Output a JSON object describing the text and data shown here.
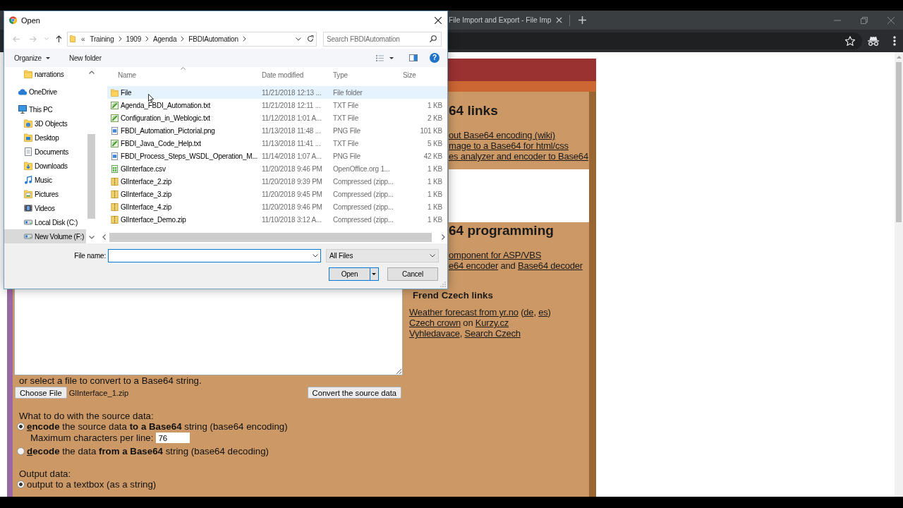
{
  "dialog": {
    "title": "Open",
    "history_buttons": [
      {
        "kind": "back",
        "disabled": true
      },
      {
        "kind": "forward",
        "disabled": true
      },
      {
        "kind": "recent",
        "disabled": true
      },
      {
        "kind": "up",
        "disabled": false
      }
    ],
    "address": {
      "overflow_mark": "«",
      "path": [
        "Training",
        "1909",
        "Agenda",
        "FBDIAutomation"
      ]
    },
    "search": {
      "placeholder": "Search FBDIAutomation"
    },
    "commands": {
      "organize": "Organize",
      "new_folder": "New folder",
      "help": "?"
    },
    "nav": [
      {
        "children": [
          {
            "label": "narrations",
            "kind": "folder",
            "selected": false
          }
        ]
      },
      {
        "label": "OneDrive",
        "kind": "cloud",
        "selected": false
      },
      {
        "label": "This PC",
        "kind": "computer",
        "selected": false,
        "children": [
          {
            "label": "3D Objects",
            "kind": "objects",
            "selected": false
          },
          {
            "label": "Desktop",
            "kind": "desktop",
            "selected": false
          },
          {
            "label": "Documents",
            "kind": "documents",
            "selected": false
          },
          {
            "label": "Downloads",
            "kind": "downloads",
            "selected": false
          },
          {
            "label": "Music",
            "kind": "music",
            "selected": false
          },
          {
            "label": "Pictures",
            "kind": "pictures",
            "selected": false
          },
          {
            "label": "Videos",
            "kind": "videos",
            "selected": false
          },
          {
            "label": "Local Disk (C:)",
            "kind": "drive",
            "selected": false
          },
          {
            "label": "New Volume (F:)",
            "kind": "drive",
            "selected": true
          }
        ]
      }
    ],
    "columns": [
      "Name",
      "Date modified",
      "Type",
      "Size"
    ],
    "files": [
      {
        "name": "File",
        "date": "11/21/2018 12:13 ...",
        "type": "File folder",
        "kind": "folder",
        "selected": true
      },
      {
        "name": "Agenda_FBDI_Automation.txt",
        "date": "11/21/2018 12:11 ...",
        "type": "TXT File",
        "size": "1 KB",
        "kind": "text",
        "selected": false
      },
      {
        "name": "Configuration_in_Weblogic.txt",
        "date": "11/12/2018 1:01 A...",
        "type": "TXT File",
        "size": "2 KB",
        "kind": "text",
        "selected": false
      },
      {
        "name": "FBDI_Automation_Pictorial.png",
        "date": "11/13/2018 11:48 ...",
        "type": "PNG File",
        "size": "101 KB",
        "kind": "image",
        "selected": false
      },
      {
        "name": "FBDI_Java_Code_Help.txt",
        "date": "11/13/2018 11:41 ...",
        "type": "TXT File",
        "size": "5 KB",
        "kind": "text",
        "selected": false
      },
      {
        "name": "FBDI_Process_Steps_WSDL_Operation_M...",
        "date": "11/14/2018 1:07 A...",
        "type": "PNG File",
        "size": "42 KB",
        "kind": "image",
        "selected": false
      },
      {
        "name": "GlInterface.csv",
        "date": "11/20/2018 9:46 PM",
        "type": "OpenOffice.org 1...",
        "size": "1 KB",
        "kind": "csv",
        "selected": false
      },
      {
        "name": "GlInterface_2.zip",
        "date": "11/20/2018 9:39 PM",
        "type": "Compressed (zipp...",
        "size": "1 KB",
        "kind": "zip",
        "selected": false
      },
      {
        "name": "GlInterface_3.zip",
        "date": "11/20/2018 9:45 PM",
        "type": "Compressed (zipp...",
        "size": "1 KB",
        "kind": "zip",
        "selected": false
      },
      {
        "name": "GlInterface_4.zip",
        "date": "11/20/2018 9:46 PM",
        "type": "Compressed (zipp...",
        "size": "1 KB",
        "kind": "zip",
        "selected": false
      },
      {
        "name": "GlInterface_Demo.zip",
        "date": "11/10/2018 3:12 A...",
        "type": "Compressed (zipp...",
        "size": "1 KB",
        "kind": "zip",
        "selected": false
      }
    ],
    "file_name_label": "File name:",
    "filter": "All Files",
    "open_button": "Open",
    "cancel_button": "Cancel"
  },
  "browser": {
    "tab_title": "File Import and Export - File Imp"
  },
  "page": {
    "right_column": [
      {
        "kind": "heading",
        "clipped": true,
        "text": "64 links"
      },
      {
        "kind": "line",
        "clipped": true,
        "parts": [
          {
            "text": "out Base64 encoding (wiki)",
            "link": true
          }
        ]
      },
      {
        "kind": "line",
        "clipped": true,
        "parts": [
          {
            "text": "mage to a Base64 for html/css",
            "link": true
          }
        ]
      },
      {
        "kind": "line",
        "clipped": true,
        "parts": [
          {
            "text": "es analyzer and encoder to Base64",
            "link": true
          }
        ]
      },
      {
        "kind": "panel",
        "clipped": true
      },
      {
        "kind": "heading",
        "clipped": true,
        "text": "64 programming"
      },
      {
        "kind": "line",
        "clipped": true,
        "parts": [
          {
            "text": "omponent for ASP/VBS",
            "link": true
          }
        ]
      },
      {
        "kind": "line",
        "clipped": true,
        "parts": [
          {
            "text": "e64 encoder",
            "link": true
          },
          {
            "text": " and ",
            "link": false
          },
          {
            "text": "Base64 decoder",
            "link": true
          }
        ]
      },
      {
        "kind": "subheading",
        "clipped": false,
        "text": "Frend Czech links"
      },
      {
        "kind": "line",
        "clipped": false,
        "parts": [
          {
            "text": "Weather forecast from yr.no",
            "link": true
          },
          {
            "text": " (",
            "link": false
          },
          {
            "text": "de",
            "link": true
          },
          {
            "text": ", ",
            "link": false
          },
          {
            "text": "es",
            "link": true
          },
          {
            "text": ")",
            "link": false
          }
        ]
      },
      {
        "kind": "line",
        "clipped": false,
        "parts": [
          {
            "text": "Czech crown",
            "link": true
          },
          {
            "text": " on ",
            "link": false
          },
          {
            "text": "Kurzy.cz",
            "link": true
          }
        ]
      },
      {
        "kind": "line",
        "clipped": false,
        "parts": [
          {
            "text": "Vyhledavace",
            "link": true
          },
          {
            "text": ", ",
            "link": false
          },
          {
            "text": "Search Czech",
            "link": true
          }
        ]
      }
    ],
    "left_column": {
      "file_prompt": "or select a file to convert to a Base64 string.",
      "choose_file_button": "Choose File",
      "chosen_file": "GlInterface_1.zip",
      "convert_button": "Convert the source data",
      "source_heading": "What to do with the source data:",
      "source_options": [
        {
          "label": "**encode** the source data **to a Base64** string (base64 encoding)",
          "selected": true,
          "setting": {
            "label": "Maximum characters per line:",
            "value": "76"
          }
        },
        {
          "label": "**decode** the data **from a Base64** string (base64 decoding)",
          "selected": false
        }
      ],
      "output_heading": "Output data:",
      "output_options": [
        {
          "label": "output to a textbox (as a string)",
          "selected": true
        }
      ]
    }
  }
}
